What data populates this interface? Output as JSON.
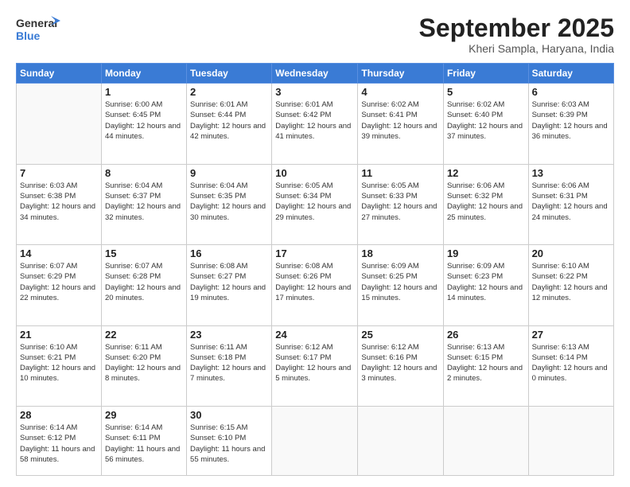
{
  "logo": {
    "line1": "General",
    "line2": "Blue"
  },
  "title": "September 2025",
  "subtitle": "Kheri Sampla, Haryana, India",
  "days_header": [
    "Sunday",
    "Monday",
    "Tuesday",
    "Wednesday",
    "Thursday",
    "Friday",
    "Saturday"
  ],
  "weeks": [
    [
      {
        "day": "",
        "empty": true
      },
      {
        "day": "1",
        "sunrise": "6:00 AM",
        "sunset": "6:45 PM",
        "daylight": "12 hours and 44 minutes."
      },
      {
        "day": "2",
        "sunrise": "6:01 AM",
        "sunset": "6:44 PM",
        "daylight": "12 hours and 42 minutes."
      },
      {
        "day": "3",
        "sunrise": "6:01 AM",
        "sunset": "6:42 PM",
        "daylight": "12 hours and 41 minutes."
      },
      {
        "day": "4",
        "sunrise": "6:02 AM",
        "sunset": "6:41 PM",
        "daylight": "12 hours and 39 minutes."
      },
      {
        "day": "5",
        "sunrise": "6:02 AM",
        "sunset": "6:40 PM",
        "daylight": "12 hours and 37 minutes."
      },
      {
        "day": "6",
        "sunrise": "6:03 AM",
        "sunset": "6:39 PM",
        "daylight": "12 hours and 36 minutes."
      }
    ],
    [
      {
        "day": "7",
        "sunrise": "6:03 AM",
        "sunset": "6:38 PM",
        "daylight": "12 hours and 34 minutes."
      },
      {
        "day": "8",
        "sunrise": "6:04 AM",
        "sunset": "6:37 PM",
        "daylight": "12 hours and 32 minutes."
      },
      {
        "day": "9",
        "sunrise": "6:04 AM",
        "sunset": "6:35 PM",
        "daylight": "12 hours and 30 minutes."
      },
      {
        "day": "10",
        "sunrise": "6:05 AM",
        "sunset": "6:34 PM",
        "daylight": "12 hours and 29 minutes."
      },
      {
        "day": "11",
        "sunrise": "6:05 AM",
        "sunset": "6:33 PM",
        "daylight": "12 hours and 27 minutes."
      },
      {
        "day": "12",
        "sunrise": "6:06 AM",
        "sunset": "6:32 PM",
        "daylight": "12 hours and 25 minutes."
      },
      {
        "day": "13",
        "sunrise": "6:06 AM",
        "sunset": "6:31 PM",
        "daylight": "12 hours and 24 minutes."
      }
    ],
    [
      {
        "day": "14",
        "sunrise": "6:07 AM",
        "sunset": "6:29 PM",
        "daylight": "12 hours and 22 minutes."
      },
      {
        "day": "15",
        "sunrise": "6:07 AM",
        "sunset": "6:28 PM",
        "daylight": "12 hours and 20 minutes."
      },
      {
        "day": "16",
        "sunrise": "6:08 AM",
        "sunset": "6:27 PM",
        "daylight": "12 hours and 19 minutes."
      },
      {
        "day": "17",
        "sunrise": "6:08 AM",
        "sunset": "6:26 PM",
        "daylight": "12 hours and 17 minutes."
      },
      {
        "day": "18",
        "sunrise": "6:09 AM",
        "sunset": "6:25 PM",
        "daylight": "12 hours and 15 minutes."
      },
      {
        "day": "19",
        "sunrise": "6:09 AM",
        "sunset": "6:23 PM",
        "daylight": "12 hours and 14 minutes."
      },
      {
        "day": "20",
        "sunrise": "6:10 AM",
        "sunset": "6:22 PM",
        "daylight": "12 hours and 12 minutes."
      }
    ],
    [
      {
        "day": "21",
        "sunrise": "6:10 AM",
        "sunset": "6:21 PM",
        "daylight": "12 hours and 10 minutes."
      },
      {
        "day": "22",
        "sunrise": "6:11 AM",
        "sunset": "6:20 PM",
        "daylight": "12 hours and 8 minutes."
      },
      {
        "day": "23",
        "sunrise": "6:11 AM",
        "sunset": "6:18 PM",
        "daylight": "12 hours and 7 minutes."
      },
      {
        "day": "24",
        "sunrise": "6:12 AM",
        "sunset": "6:17 PM",
        "daylight": "12 hours and 5 minutes."
      },
      {
        "day": "25",
        "sunrise": "6:12 AM",
        "sunset": "6:16 PM",
        "daylight": "12 hours and 3 minutes."
      },
      {
        "day": "26",
        "sunrise": "6:13 AM",
        "sunset": "6:15 PM",
        "daylight": "12 hours and 2 minutes."
      },
      {
        "day": "27",
        "sunrise": "6:13 AM",
        "sunset": "6:14 PM",
        "daylight": "12 hours and 0 minutes."
      }
    ],
    [
      {
        "day": "28",
        "sunrise": "6:14 AM",
        "sunset": "6:12 PM",
        "daylight": "11 hours and 58 minutes."
      },
      {
        "day": "29",
        "sunrise": "6:14 AM",
        "sunset": "6:11 PM",
        "daylight": "11 hours and 56 minutes."
      },
      {
        "day": "30",
        "sunrise": "6:15 AM",
        "sunset": "6:10 PM",
        "daylight": "11 hours and 55 minutes."
      },
      {
        "day": "",
        "empty": true
      },
      {
        "day": "",
        "empty": true
      },
      {
        "day": "",
        "empty": true
      },
      {
        "day": "",
        "empty": true
      }
    ]
  ]
}
